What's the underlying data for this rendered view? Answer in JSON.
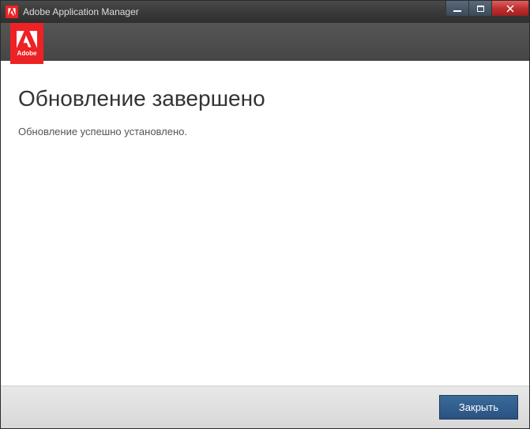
{
  "titlebar": {
    "app_name": "Adobe Application Manager"
  },
  "header": {
    "logo_text": "Adobe"
  },
  "content": {
    "title": "Обновление завершено",
    "message": "Обновление успешно установлено."
  },
  "footer": {
    "close_label": "Закрыть"
  }
}
